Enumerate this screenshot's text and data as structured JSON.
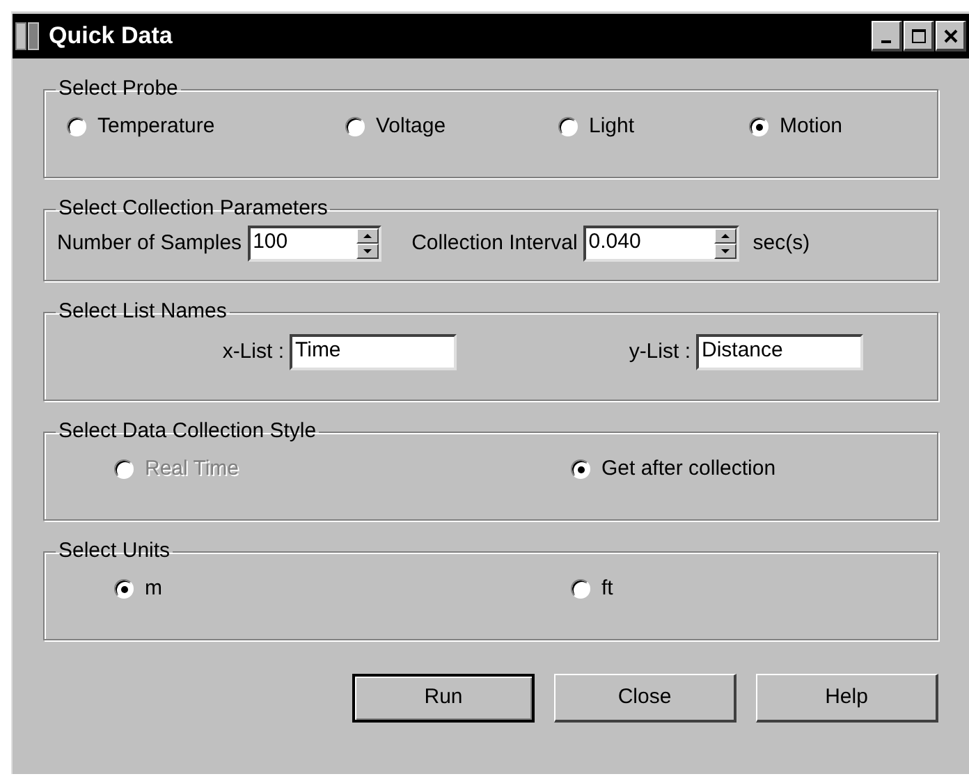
{
  "window": {
    "title": "Quick Data"
  },
  "probe": {
    "title": "Select Probe",
    "options": [
      {
        "label": "Temperature",
        "selected": false
      },
      {
        "label": "Voltage",
        "selected": false
      },
      {
        "label": "Light",
        "selected": false
      },
      {
        "label": "Motion",
        "selected": true
      }
    ]
  },
  "parameters": {
    "title": "Select Collection Parameters",
    "samples_label": "Number of Samples",
    "samples_value": "100",
    "interval_label": "Collection Interval",
    "interval_value": "0.040",
    "interval_unit": "sec(s)"
  },
  "list_names": {
    "title": "Select List Names",
    "x_label": "x-List :",
    "x_value": "Time",
    "y_label": "y-List :",
    "y_value": "Distance"
  },
  "collection_style": {
    "title": "Select Data Collection Style",
    "options": [
      {
        "label": "Real Time",
        "selected": false,
        "disabled": true
      },
      {
        "label": "Get after collection",
        "selected": true,
        "disabled": false
      }
    ]
  },
  "units": {
    "title": "Select Units",
    "options": [
      {
        "label": "m",
        "selected": true
      },
      {
        "label": "ft",
        "selected": false
      }
    ]
  },
  "buttons": [
    {
      "label": "Run",
      "default": true
    },
    {
      "label": "Close",
      "default": false
    },
    {
      "label": "Help",
      "default": false
    }
  ]
}
